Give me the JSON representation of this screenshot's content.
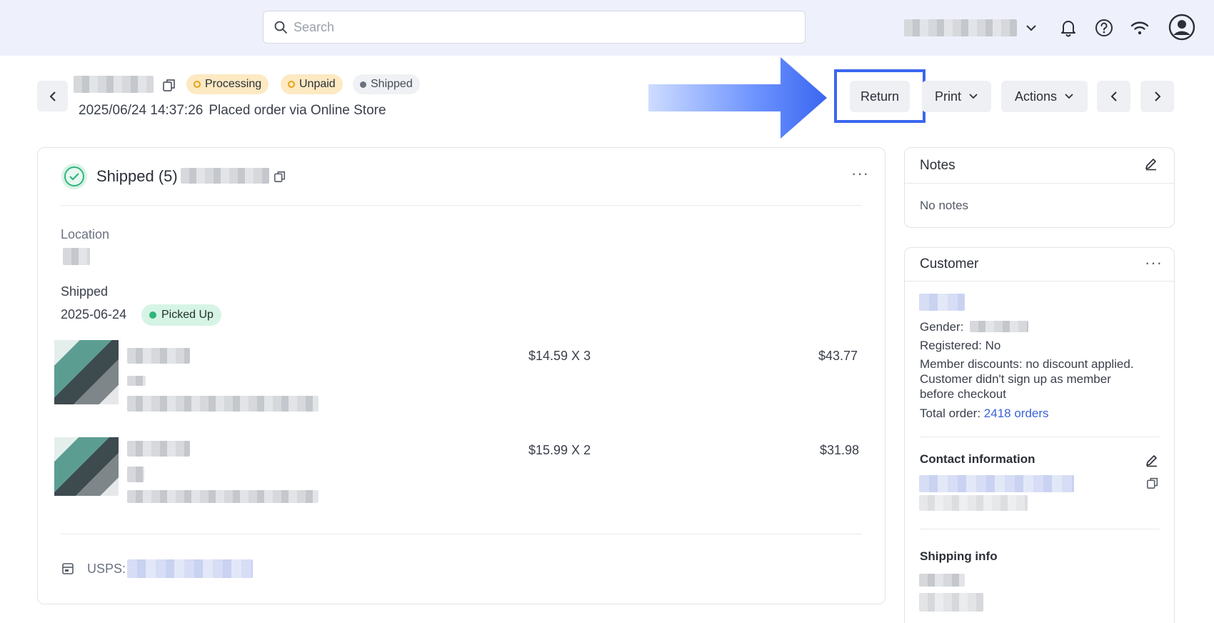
{
  "search": {
    "placeholder": "Search"
  },
  "header": {
    "statuses": {
      "processing": "Processing",
      "unpaid": "Unpaid",
      "shipped": "Shipped"
    },
    "timestamp": "2025/06/24 14:37:26",
    "placed_via": "Placed order via Online Store"
  },
  "toolbar": {
    "return_label": "Return",
    "print_label": "Print",
    "actions_label": "Actions"
  },
  "shipment": {
    "title": "Shipped (5)",
    "location_label": "Location",
    "shipped_label": "Shipped",
    "shipped_date": "2025-06-24",
    "picked_up": "Picked Up",
    "items": [
      {
        "unit": "$14.59 X 3",
        "total": "$43.77"
      },
      {
        "unit": "$15.99 X 2",
        "total": "$31.98"
      }
    ],
    "carrier_label": "USPS:"
  },
  "notes": {
    "title": "Notes",
    "empty": "No notes"
  },
  "customer": {
    "title": "Customer",
    "gender_label": "Gender:",
    "registered": "Registered: No",
    "member_discount_1": "Member discounts: no discount applied.",
    "member_discount_2": "Customer didn't sign up as member",
    "member_discount_3": "before checkout",
    "total_order_label": "Total order:",
    "total_order_link": "2418 orders",
    "contact_title": "Contact information",
    "shipping_title": "Shipping info"
  },
  "colors": {
    "accent": "#3a66f0",
    "warning_pill": "#fde9c2",
    "success_pill": "#d6f4e5",
    "link": "#3b63d8"
  }
}
